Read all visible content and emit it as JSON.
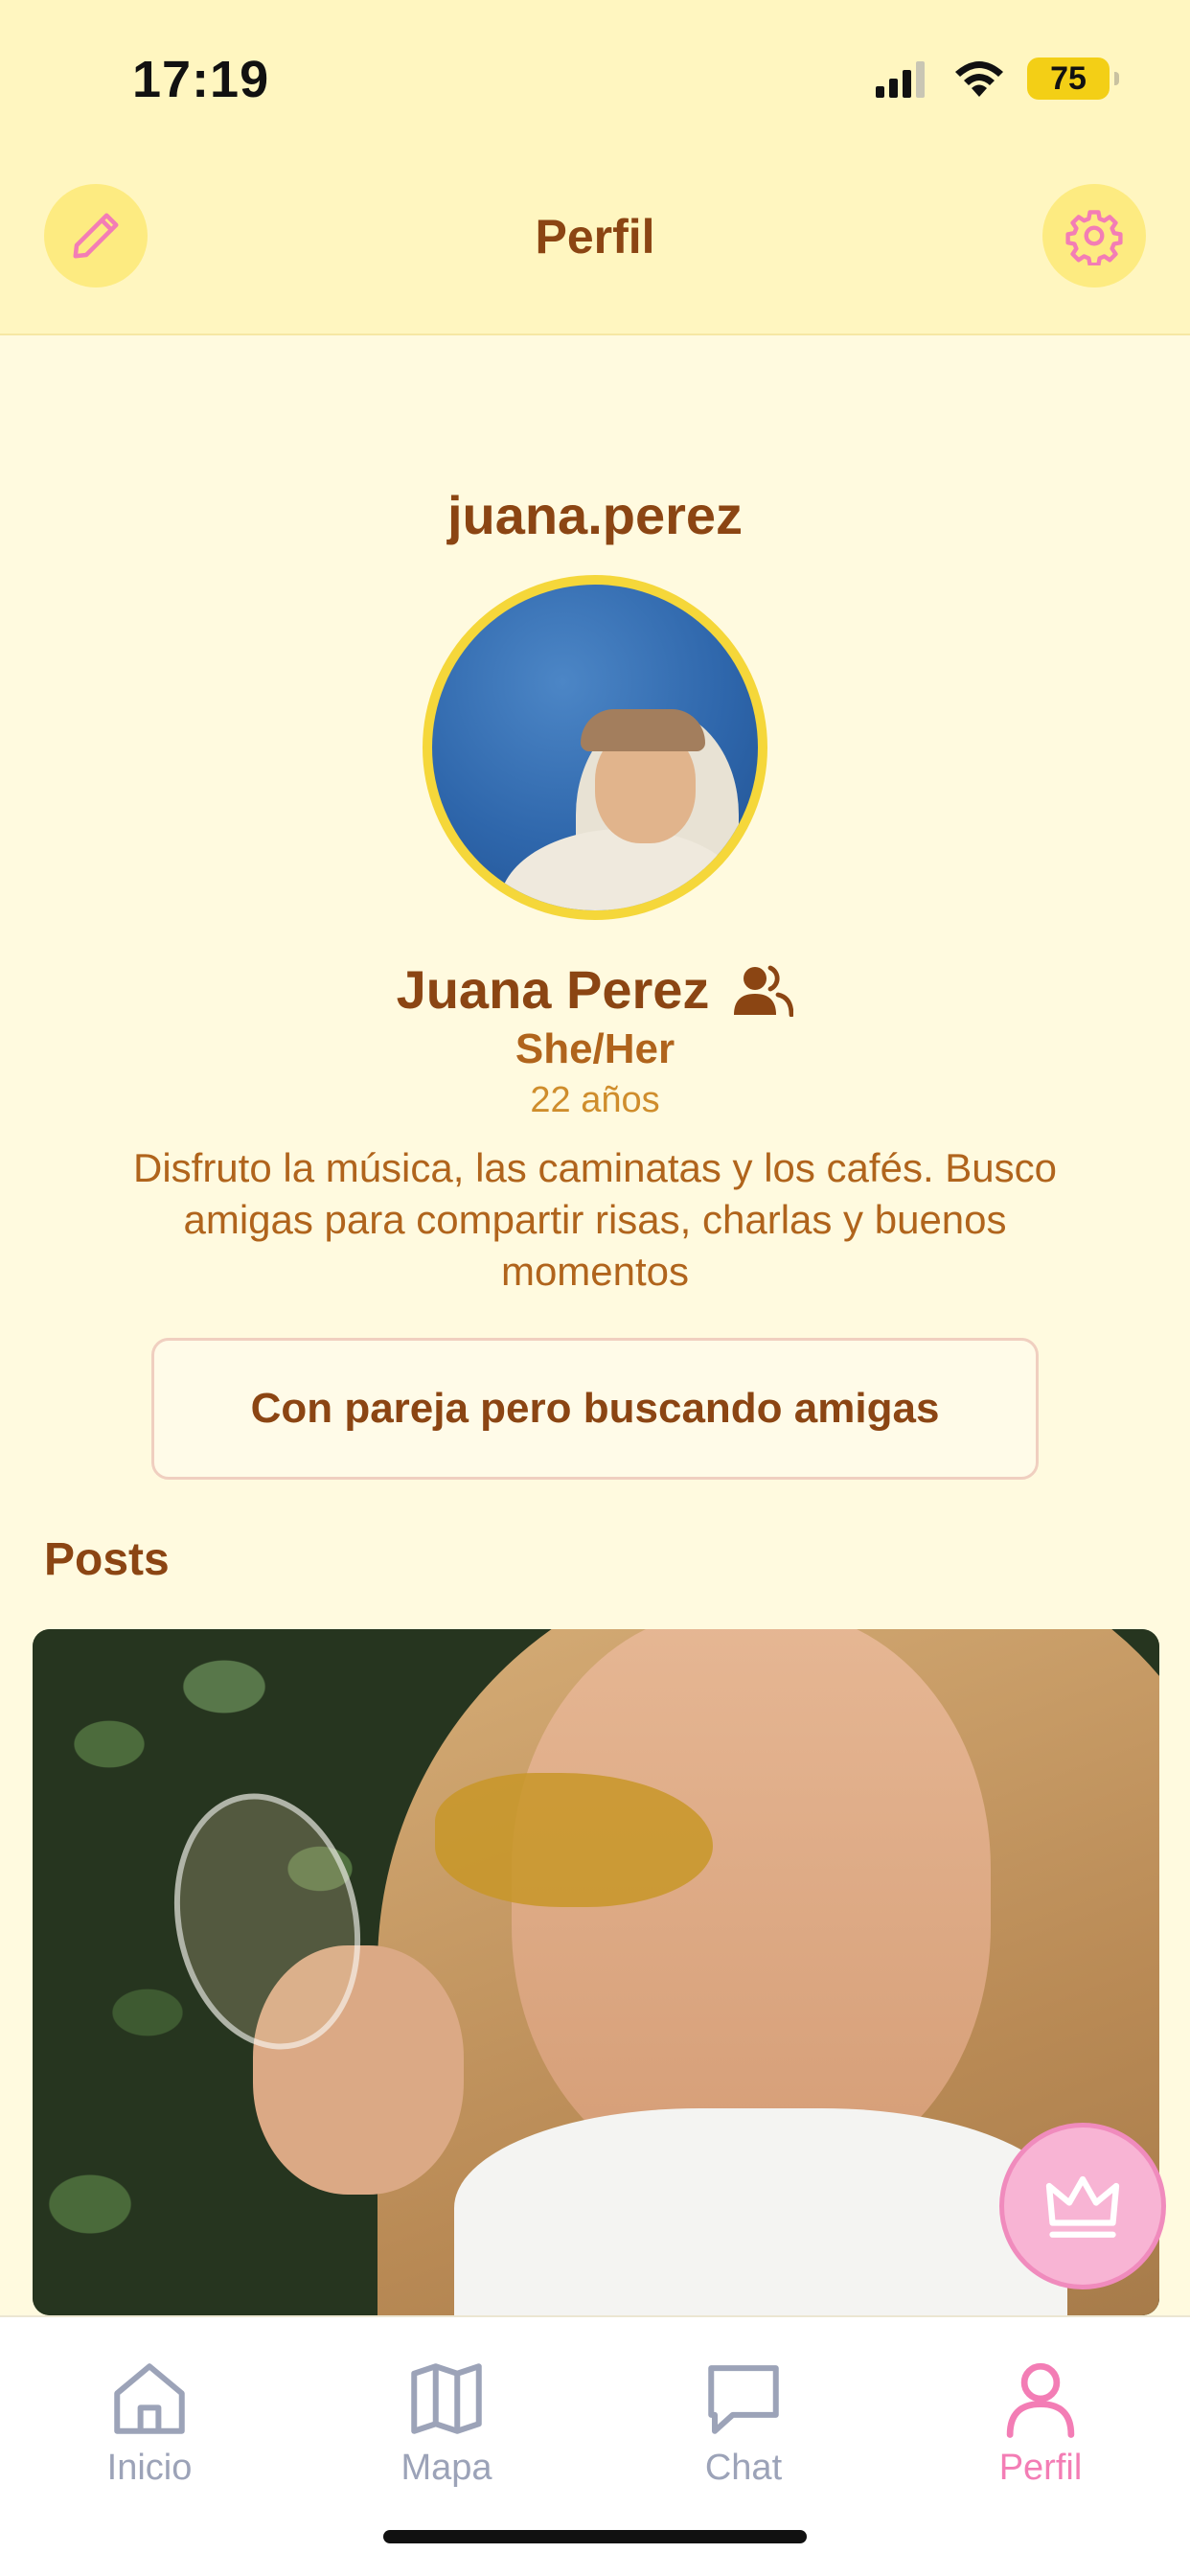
{
  "status_bar": {
    "time": "17:19",
    "battery": "75",
    "icons": [
      "signal-icon",
      "wifi-icon",
      "battery-icon"
    ]
  },
  "header": {
    "title": "Perfil",
    "left_icon": "pencil-icon",
    "right_icon": "gear-icon"
  },
  "profile": {
    "username": "juana.perez",
    "full_name": "Juana Perez",
    "friends_icon": "users-icon",
    "pronouns": "She/Her",
    "age": "22 años",
    "bio": "Disfruto la música, las caminatas y los cafés. Busco amigas para compartir risas, charlas y buenos momentos",
    "status": "Con pareja pero buscando amigas"
  },
  "posts": {
    "title": "Posts"
  },
  "fab": {
    "icon": "crown-icon"
  },
  "tabbar": {
    "tabs": [
      {
        "label": "Inicio",
        "icon": "home-icon"
      },
      {
        "label": "Mapa",
        "icon": "map-icon"
      },
      {
        "label": "Chat",
        "icon": "chat-icon"
      },
      {
        "label": "Perfil",
        "icon": "user-icon",
        "active": true
      }
    ]
  },
  "colors": {
    "accent": "#8b4513",
    "header_bg": "#fff6c0",
    "page_bg": "#fffadf",
    "active_tab": "#f37db5",
    "inactive_tab": "#9ca3b8",
    "avatar_ring": "#f5d73a"
  }
}
